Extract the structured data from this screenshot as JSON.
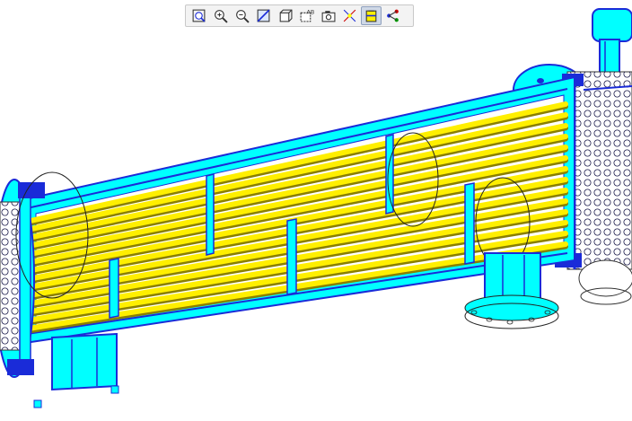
{
  "viewer": {
    "toolbar": {
      "tools": [
        {
          "icon": "zoom-fit-icon",
          "active": false
        },
        {
          "icon": "zoom-in-icon",
          "active": false
        },
        {
          "icon": "zoom-out-icon",
          "active": false
        },
        {
          "icon": "section-view-icon",
          "active": false
        },
        {
          "icon": "view-orientation-icon",
          "active": false
        },
        {
          "icon": "display-style-icon",
          "active": false
        },
        {
          "icon": "camera-icon",
          "active": false
        },
        {
          "icon": "explode-icon",
          "active": false
        },
        {
          "icon": "section-plane-icon",
          "active": true
        },
        {
          "icon": "share-icon",
          "active": false
        }
      ]
    },
    "model": {
      "name": "shell-and-tube-heat-exchanger-cutaway",
      "colors": {
        "shell": "#00ffff",
        "edges": "#1a2bd8",
        "tubes": "#ffef00",
        "tube-shadow": "#8a7f00",
        "background": "#ffffff"
      }
    }
  }
}
